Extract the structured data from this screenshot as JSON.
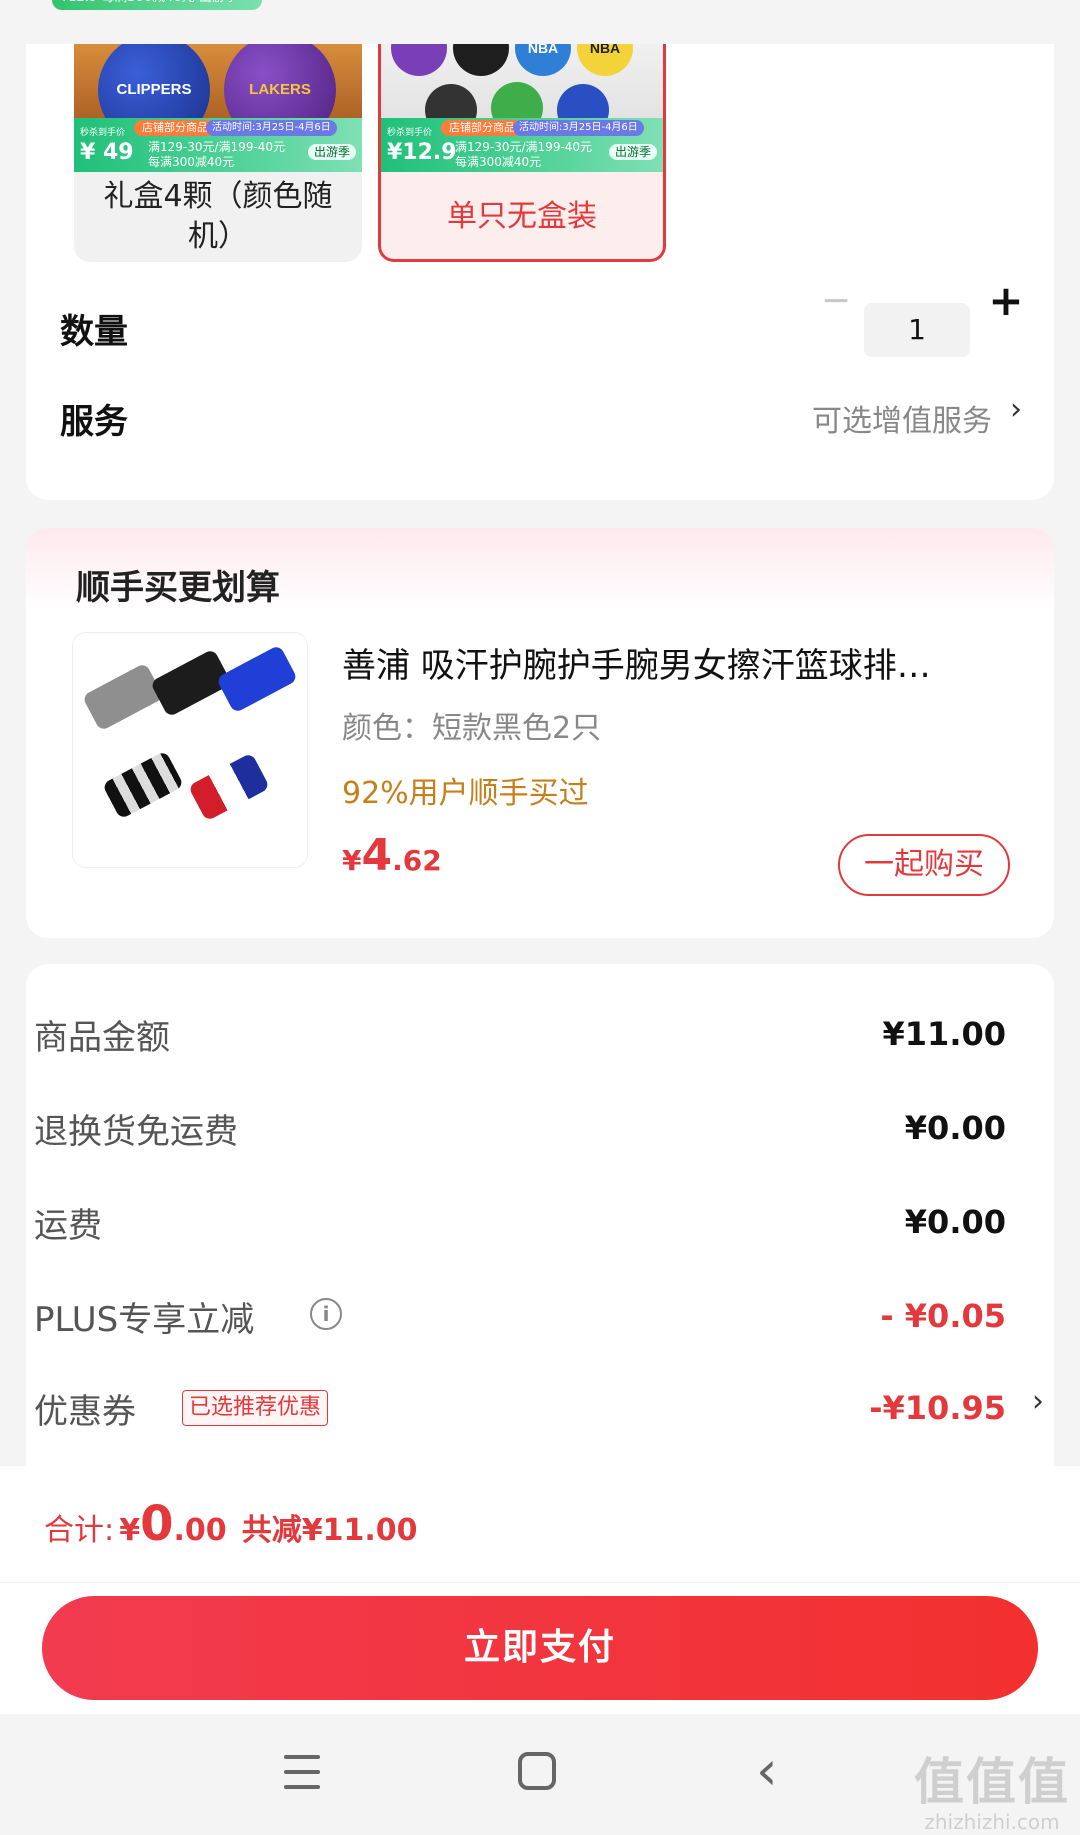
{
  "top_badge": {
    "text": "¥12.9 每满300减40元 出游季"
  },
  "variants": [
    {
      "label": "礼盒4颗（颜色随机）",
      "selected": false,
      "price_label": "秒杀到手价",
      "price": "¥ 49",
      "promo_pill": "店铺部分商品",
      "promo_time": "活动时间:3月25日-4月6日",
      "promo_rules": "满129-30元/满199-40元\n每满300减40元",
      "promo_trip": "出游季"
    },
    {
      "label": "单只无盒装",
      "selected": true,
      "price_label": "秒杀到手价",
      "price": "¥12.9",
      "promo_pill": "店铺部分商品",
      "promo_time": "活动时间:3月25日-4月6日",
      "promo_rules": "满129-30元/满199-40元\n每满300减40元",
      "promo_trip": "出游季"
    }
  ],
  "ball_labels": [
    "CLIPPERS",
    "LAKERS",
    "NBA",
    "NBA"
  ],
  "quantity": {
    "label": "数量",
    "value": "1",
    "minus": "−",
    "plus": "+"
  },
  "service": {
    "label": "服务",
    "value": "可选增值服务",
    "chevron": "›"
  },
  "recommend": {
    "title": "顺手买更划算",
    "name": "善浦 吸汗护腕护手腕男女擦汗篮球排…",
    "color": "颜色：短款黑色2只",
    "social": "92%用户顺手买过",
    "price_currency": "¥",
    "price_int": "4",
    "price_dec": ".62",
    "buy_button": "一起购买"
  },
  "fees": [
    {
      "label": "商品金额",
      "value": "¥11.00",
      "red": false
    },
    {
      "label": "退换货免运费",
      "value": "¥0.00",
      "red": false
    },
    {
      "label": "运费",
      "value": "¥0.00",
      "red": false
    },
    {
      "label": "PLUS专享立减",
      "value": "- ¥0.05",
      "red": true
    },
    {
      "label": "优惠券",
      "value": "-¥10.95",
      "red": true
    }
  ],
  "info_icon": "i",
  "coupon_tag": "已选推荐优惠",
  "coupon_chevron": "›",
  "total": {
    "label": "合计:",
    "currency": "¥",
    "int": "0",
    "dec": ".00",
    "saved": "共减¥11.00"
  },
  "pay_button": "立即支付",
  "nav_back": "‹",
  "watermark": {
    "main": "值值值",
    "sub": "zhizhizhi.com"
  },
  "colors": {
    "accent": "#e4393c",
    "social": "#c77f1a"
  }
}
